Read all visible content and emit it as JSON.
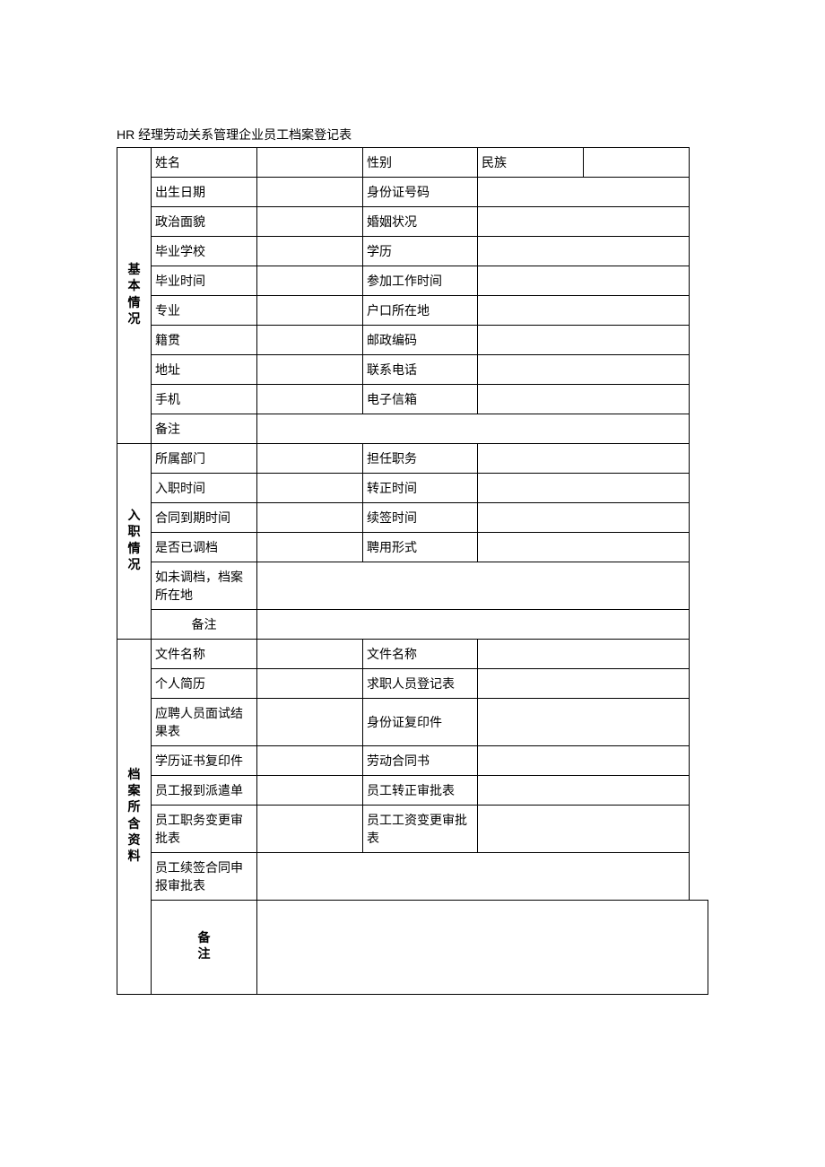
{
  "title": "HR 经理劳动关系管理企业员工档案登记表",
  "sections": {
    "basic": {
      "header": "基本情况",
      "rows": {
        "name": "姓名",
        "gender": "性别",
        "ethnicity": "民族",
        "birthdate": "出生日期",
        "id_number": "身份证号码",
        "political": "政治面貌",
        "marital": "婚姻状况",
        "school": "毕业学校",
        "education": "学历",
        "graduation_time": "毕业时间",
        "work_start": "参加工作时间",
        "major": "专业",
        "hukou": "户口所在地",
        "native_place": "籍贯",
        "postal_code": "邮政编码",
        "address": "地址",
        "phone": "联系电话",
        "mobile": "手机",
        "email": "电子信箱",
        "remark": "备注"
      }
    },
    "employment": {
      "header": "入职情况",
      "rows": {
        "department": "所属部门",
        "position": "担任职务",
        "entry_date": "入职时间",
        "regular_date": "转正时间",
        "contract_expire": "合同到期时间",
        "renewal_date": "续签时间",
        "transferred": "是否已调档",
        "employment_type": "聘用形式",
        "archive_location": "如未调档，档案所在地",
        "remark": "备注"
      }
    },
    "documents": {
      "header": "档案所含资料",
      "rows": {
        "file_name_1": "文件名称",
        "file_name_2": "文件名称",
        "resume": "个人简历",
        "job_reg": "求职人员登记表",
        "interview_result": "应聘人员面试结果表",
        "id_copy": "身份证复印件",
        "diploma_copy": "学历证书复印件",
        "labor_contract": "劳动合同书",
        "dispatch_form": "员工报到派遣单",
        "regular_approval": "员工转正审批表",
        "position_change": "员工职务变更审批表",
        "salary_change": "员工工资变更审批表",
        "renewal_approval": "员工续签合同申报审批表"
      }
    },
    "remark": {
      "header": "备注"
    }
  }
}
